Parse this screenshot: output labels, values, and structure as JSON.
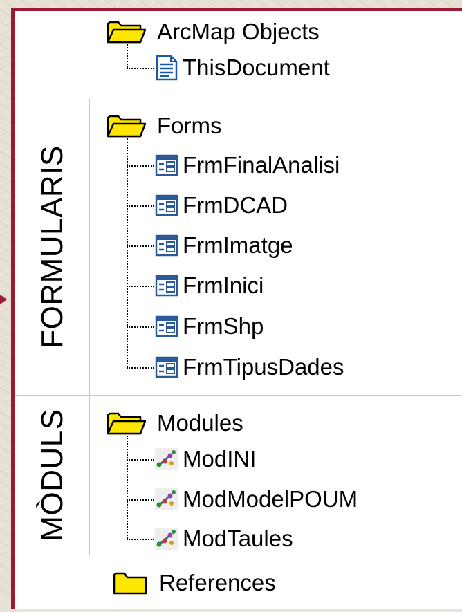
{
  "colors": {
    "frame": "#9b1b34",
    "folder_fill": "#ffe600",
    "folder_stroke": "#000000",
    "form_icon": "#2a5a9a",
    "doc_icon": "#1b5aa8"
  },
  "tree": {
    "arcmap": {
      "label": "ArcMap Objects",
      "icon": "folder-open-icon",
      "children": [
        {
          "label": "ThisDocument",
          "icon": "document-icon"
        }
      ]
    },
    "forms": {
      "side_label": "FORMULARIS",
      "label": "Forms",
      "icon": "folder-open-icon",
      "children": [
        {
          "label": "FrmFinalAnalisi",
          "icon": "form-icon"
        },
        {
          "label": "FrmDCAD",
          "icon": "form-icon"
        },
        {
          "label": "FrmImatge",
          "icon": "form-icon"
        },
        {
          "label": "FrmInici",
          "icon": "form-icon"
        },
        {
          "label": "FrmShp",
          "icon": "form-icon"
        },
        {
          "label": "FrmTipusDades",
          "icon": "form-icon"
        }
      ]
    },
    "modules": {
      "side_label": "MÒDULS",
      "label": "Modules",
      "icon": "folder-open-icon",
      "children": [
        {
          "label": "ModINI",
          "icon": "module-icon"
        },
        {
          "label": "ModModelPOUM",
          "icon": "module-icon"
        },
        {
          "label": "ModTaules",
          "icon": "module-icon"
        }
      ]
    },
    "references": {
      "label": "References",
      "icon": "folder-closed-icon"
    }
  }
}
